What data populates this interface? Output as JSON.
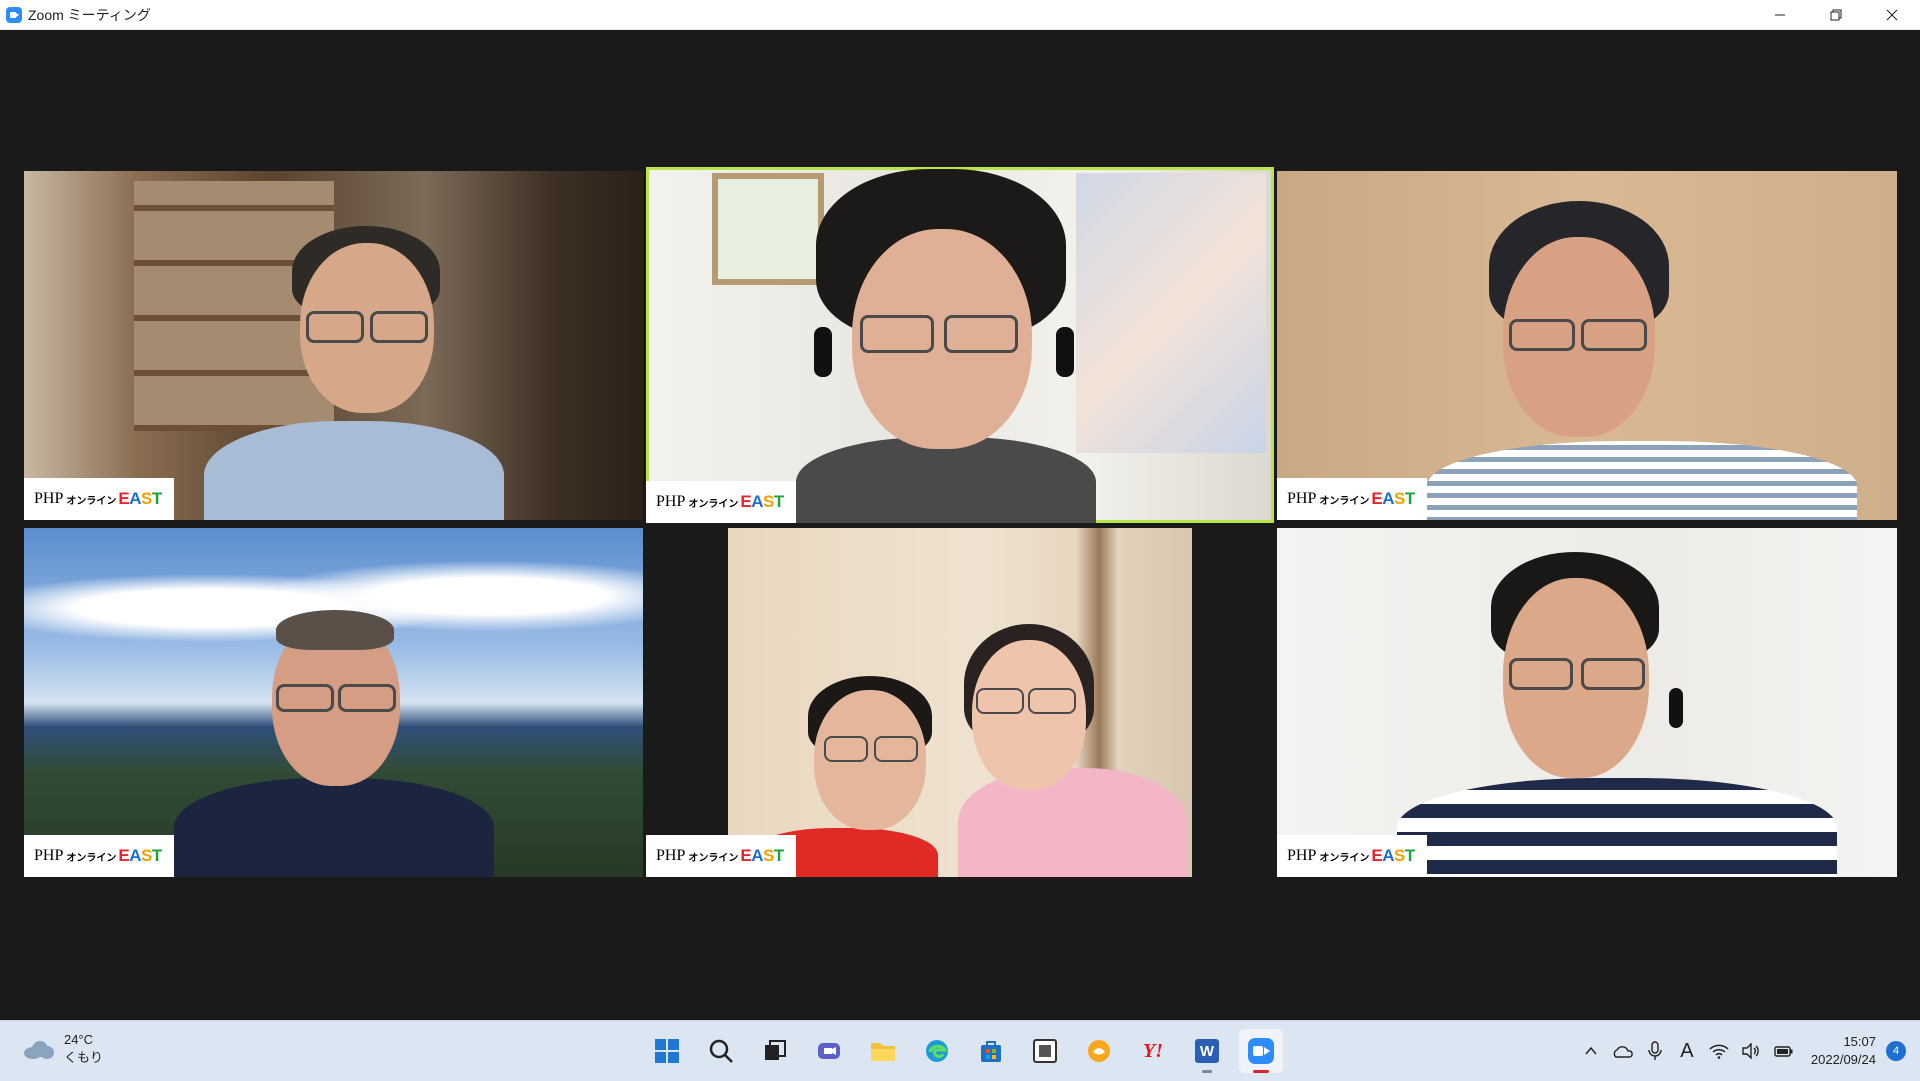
{
  "window": {
    "title": "Zoom ミーティング",
    "controls": [
      "minimize",
      "restore",
      "close"
    ]
  },
  "meeting": {
    "participants": [
      {
        "label_php": "PHP",
        "label_ol": "オンライン",
        "label_east": "EAST",
        "active": false
      },
      {
        "label_php": "PHP",
        "label_ol": "オンライン",
        "label_east": "EAST",
        "active": true
      },
      {
        "label_php": "PHP",
        "label_ol": "オンライン",
        "label_east": "EAST",
        "active": false
      },
      {
        "label_php": "PHP",
        "label_ol": "オンライン",
        "label_east": "EAST",
        "active": false
      },
      {
        "label_php": "PHP",
        "label_ol": "オンライン",
        "label_east": "EAST",
        "active": false
      },
      {
        "label_php": "PHP",
        "label_ol": "オンライン",
        "label_east": "EAST",
        "active": false
      }
    ],
    "active_speaker_color": "#b8e64a"
  },
  "taskbar": {
    "weather": {
      "temp": "24°C",
      "condition": "くもり",
      "icon": "cloud-icon"
    },
    "apps": [
      "start-icon",
      "search-icon",
      "task-view-icon",
      "chat-icon",
      "file-explorer-icon",
      "edge-icon",
      "store-icon",
      "app-icon",
      "app-icon-orange",
      "yahoo-icon",
      "word-icon",
      "zoom-icon"
    ],
    "yahoo_text": "Y!",
    "word_text": "W",
    "tray_icons": [
      "chevron-up-icon",
      "onedrive-icon",
      "mic-icon",
      "ime-icon",
      "wifi-icon",
      "volume-icon",
      "battery-icon"
    ],
    "ime_text": "A",
    "time": "15:07",
    "date": "2022/09/24",
    "notifications": "4"
  }
}
